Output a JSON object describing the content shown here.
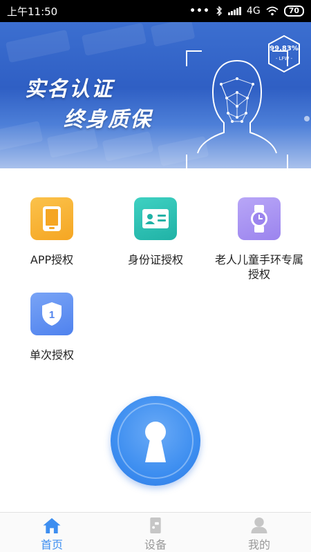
{
  "status_bar": {
    "time": "上午11:50",
    "network": "4G",
    "battery": "70"
  },
  "banner": {
    "line1": "实名认证",
    "line2": "终身质保",
    "badge": {
      "percent": "99.83%",
      "sub": "- LFW -"
    }
  },
  "grid": {
    "items": [
      {
        "label": "APP授权",
        "icon": "phone-icon",
        "color": "#f5a623"
      },
      {
        "label": "身份证授权",
        "icon": "id-card-icon",
        "color": "#20b2a6"
      },
      {
        "label": "老人儿童手环专属授权",
        "icon": "watch-icon",
        "color": "#9b84ee"
      },
      {
        "label": "单次授权",
        "icon": "shield-icon",
        "color": "#4f82ee"
      }
    ]
  },
  "key_button": {
    "icon": "keyhole-icon",
    "color": "#3d8ef0"
  },
  "bottom_nav": {
    "items": [
      {
        "label": "首页",
        "icon": "home-icon",
        "active": true
      },
      {
        "label": "设备",
        "icon": "device-icon",
        "active": false
      },
      {
        "label": "我的",
        "icon": "user-icon",
        "active": false
      }
    ],
    "active_color": "#3d8ef0"
  }
}
